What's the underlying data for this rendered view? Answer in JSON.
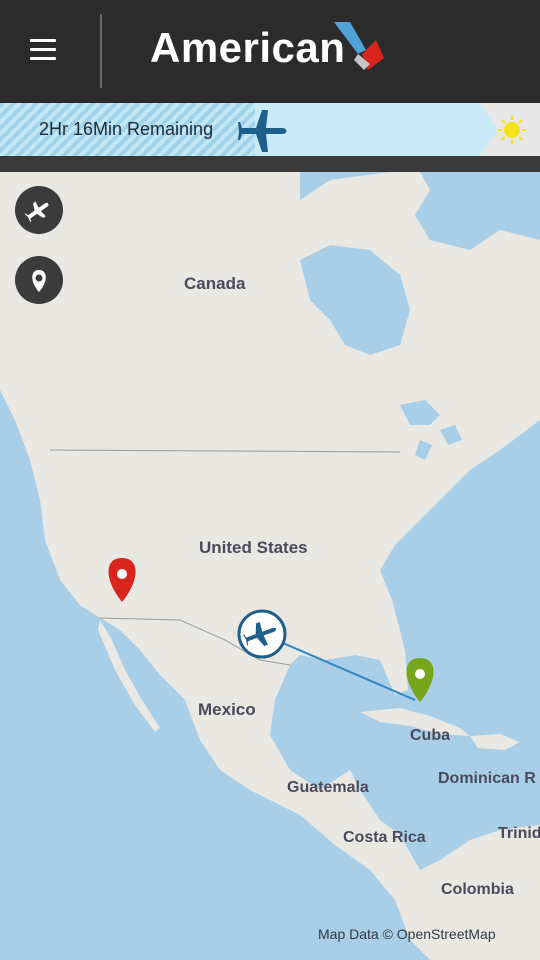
{
  "header": {
    "brand": "American",
    "menu_icon": "hamburger-menu-icon",
    "logo_icon": "american-airlines-flight-symbol"
  },
  "flight_status": {
    "remaining_text": "2Hr 16Min Remaining",
    "progress_fraction": 0.49,
    "plane_icon": "plane-icon",
    "weather_icon": "sun-icon"
  },
  "map_controls": {
    "flight_button_icon": "plane-icon",
    "location_button_icon": "location-pin-icon"
  },
  "map": {
    "labels": {
      "canada": "Canada",
      "united_states": "United States",
      "mexico": "Mexico",
      "cuba": "Cuba",
      "guatemala": "Guatemala",
      "dominican_republic": "Dominican R",
      "costa_rica": "Costa Rica",
      "trinidad": "Trinid",
      "colombia": "Colombia"
    },
    "origin_marker_color": "#d9261c",
    "destination_marker_color": "#77a51c",
    "route_color": "#2f86c4",
    "attribution": "Map Data © OpenStreetMap"
  },
  "colors": {
    "header_bg": "#2b2b2b",
    "progress_fill": "#c9ebf7",
    "plane_accent": "#1f5f8b",
    "water": "#a9cfe8",
    "land": "#e9e8e3"
  }
}
